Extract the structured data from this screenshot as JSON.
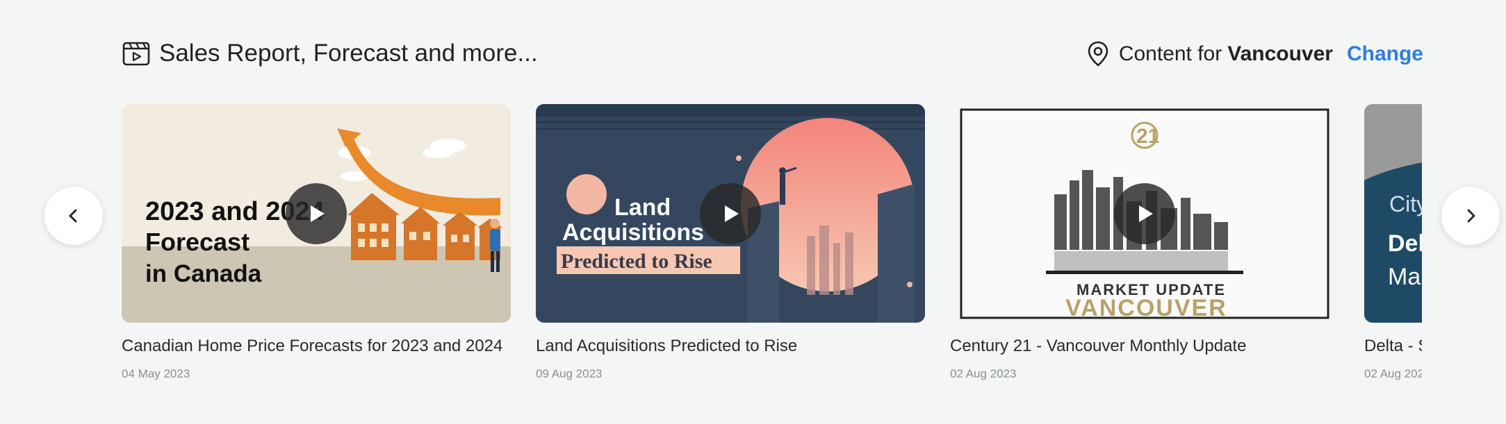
{
  "header": {
    "title": "Sales Report, Forecast and more...",
    "icon": "video-calendar-icon",
    "location_prefix": "Content for",
    "location_city": "Vancouver",
    "change_label": "Change",
    "location_icon": "map-pin-icon",
    "accent_color": "#2f7de1"
  },
  "navigation": {
    "prev_icon": "chevron-left-icon",
    "next_icon": "chevron-right-icon"
  },
  "videos": [
    {
      "title": "Canadian Home Price Forecasts for 2023 and 2024",
      "date": "04 May 2023",
      "thumb_lines": [
        "2023 and 2024",
        "Forecast",
        "in Canada"
      ]
    },
    {
      "title": "Land Acquisitions Predicted to Rise",
      "date": "09 Aug 2023",
      "thumb_lines": [
        "Land",
        "Acquisitions",
        "Predicted to Rise"
      ]
    },
    {
      "title": "Century 21 - Vancouver Monthly Update",
      "date": "02 Aug 2023",
      "thumb_lines": [
        "21",
        "MARKET UPDATE",
        "VANCOUVER"
      ]
    },
    {
      "title": "Delta - S",
      "date": "02 Aug 202",
      "thumb_lines": [
        "City",
        "Del",
        "Ma"
      ]
    }
  ]
}
